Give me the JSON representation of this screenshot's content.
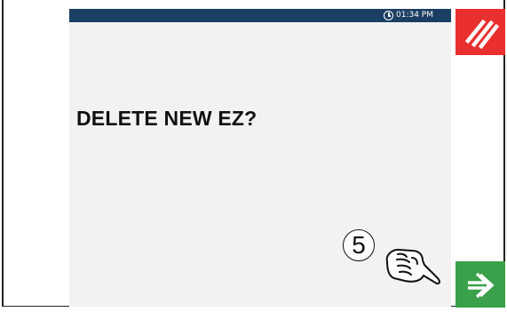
{
  "status_bar": {
    "time": "01:34 PM",
    "icon": "clock-icon"
  },
  "dialog": {
    "title": "DELETE NEW EZ?"
  },
  "buttons": {
    "cancel": {
      "icon": "cancel-slash-icon",
      "color": "#ea2f2f"
    },
    "confirm": {
      "icon": "arrow-right-icon",
      "color": "#3aa04a"
    }
  },
  "annotation": {
    "callout_number": "5",
    "icon": "hand-pointer-icon"
  }
}
